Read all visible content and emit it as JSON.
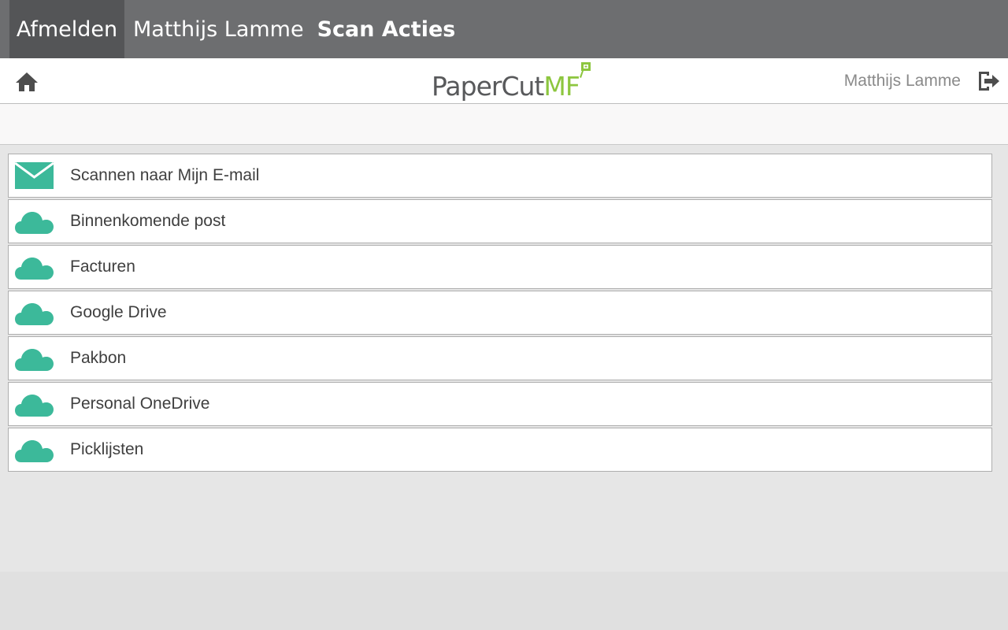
{
  "topbar": {
    "logout_label": "Afmelden",
    "user_name": "Matthijs Lamme",
    "title": "Scan Acties"
  },
  "header": {
    "logo_text": "PaperCut",
    "logo_suffix": "MF",
    "user_name": "Matthijs Lamme"
  },
  "colors": {
    "accent": "#3cb99a",
    "topbar": "#6d6e70",
    "logo_green": "#8dc63f"
  },
  "actions": [
    {
      "label": "Scannen naar Mijn E-mail",
      "icon": "envelope-icon"
    },
    {
      "label": "Binnenkomende post",
      "icon": "cloud-icon"
    },
    {
      "label": "Facturen",
      "icon": "cloud-icon"
    },
    {
      "label": "Google Drive",
      "icon": "cloud-icon"
    },
    {
      "label": "Pakbon",
      "icon": "cloud-icon"
    },
    {
      "label": "Personal OneDrive",
      "icon": "cloud-icon"
    },
    {
      "label": "Picklijsten",
      "icon": "cloud-icon"
    }
  ]
}
